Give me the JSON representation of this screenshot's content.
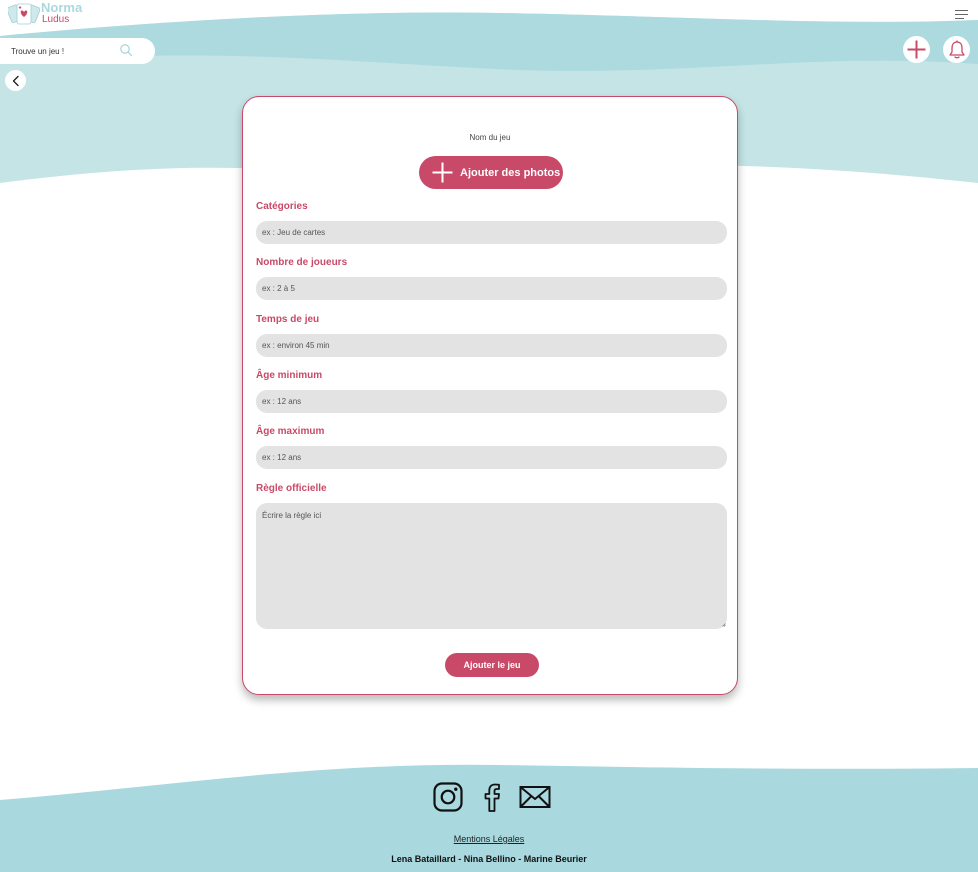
{
  "header": {
    "brand_title": "Norma",
    "brand_subtitle": "Ludus",
    "search_placeholder": "Trouve un jeu !"
  },
  "form": {
    "game_name": "Nom du jeu",
    "add_photos_label": "Ajouter des photos",
    "fields": [
      {
        "label": "Catégories",
        "placeholder": "ex : Jeu de cartes"
      },
      {
        "label": "Nombre de joueurs",
        "placeholder": "ex : 2 à 5"
      },
      {
        "label": "Temps de jeu",
        "placeholder": "ex : environ 45 min"
      },
      {
        "label": "Âge minimum",
        "placeholder": "ex : 12 ans"
      },
      {
        "label": "Âge maximum",
        "placeholder": "ex : 12 ans"
      }
    ],
    "rules_label": "Règle officielle",
    "rules_placeholder": "Écrire la règle ici",
    "submit_label": "Ajouter le jeu"
  },
  "footer": {
    "legal_link": "Mentions Légales",
    "credits": "Lena Bataillard - Nina Bellino - Marine Beurier"
  },
  "colors": {
    "accent": "#c84a68",
    "wave_light": "#c5e4e6",
    "wave_mid": "#a9d9df",
    "input_bg": "#e3e3e3"
  },
  "icons": {
    "menu": "hamburger-icon",
    "search": "search-icon",
    "add": "plus-icon",
    "notifications": "bell-icon",
    "back": "chevron-left-icon",
    "instagram": "instagram-icon",
    "facebook": "facebook-icon",
    "email": "mail-icon"
  }
}
